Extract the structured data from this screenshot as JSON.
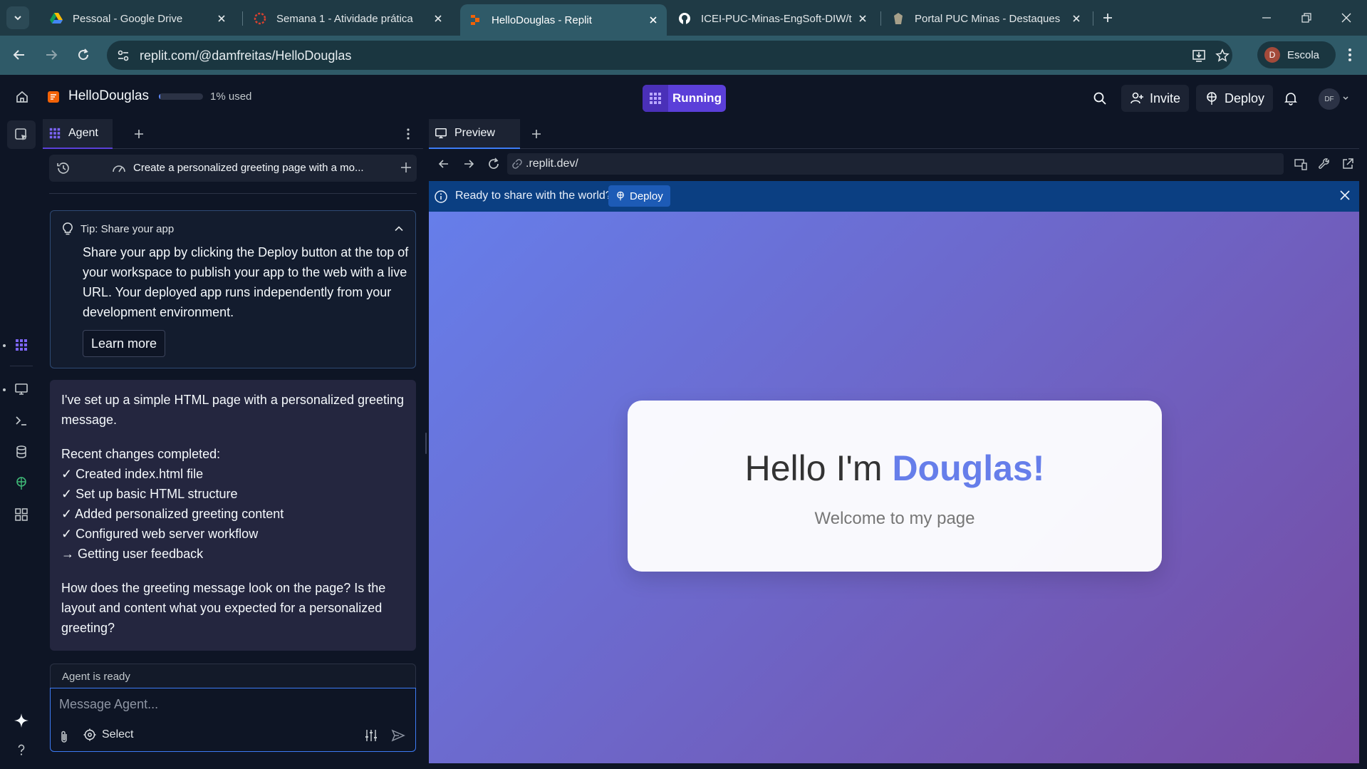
{
  "browser": {
    "tabs": [
      {
        "title": "Pessoal - Google Drive",
        "icon": "google-drive-icon"
      },
      {
        "title": "Semana 1 - Atividade prática",
        "icon": "puc-logo-icon"
      },
      {
        "title": "HelloDouglas - Replit",
        "icon": "replit-icon",
        "active": true
      },
      {
        "title": "ICEI-PUC-Minas-EngSoft-DIW/t",
        "icon": "github-icon"
      },
      {
        "title": "Portal PUC Minas - Destaques",
        "icon": "puc-portal-icon"
      }
    ],
    "url": "replit.com/@damfreitas/HelloDouglas",
    "profile_initial": "D",
    "profile_name": "Escola"
  },
  "header": {
    "project_name": "HelloDouglas",
    "usage_percent": 1,
    "usage_text": "1% used",
    "run_label": "Running",
    "invite_label": "Invite",
    "deploy_label": "Deploy",
    "user_initials": "DF"
  },
  "agent": {
    "tab_label": "Agent",
    "thread_title": "Create a personalized greeting page with a mo...",
    "tip": {
      "title": "Tip: Share your app",
      "body": "Share your app by clicking the Deploy button at the top of your workspace to publish your app to the web with a live URL. Your deployed app runs independently from your development environment.",
      "button": "Learn more"
    },
    "message": {
      "intro": "I've set up a simple HTML page with a personalized greeting message.",
      "changes_heading": "Recent changes completed:",
      "changes": [
        "✓ Created index.html file",
        "✓ Set up basic HTML structure",
        "✓ Added personalized greeting content",
        "✓ Configured web server workflow",
        "→ Getting user feedback"
      ],
      "question": "How does the greeting message look on the page? Is the layout and content what you expected for a personalized greeting?"
    },
    "status": "Agent is ready",
    "input_placeholder": "Message Agent...",
    "select_label": "Select"
  },
  "preview": {
    "tab_label": "Preview",
    "url": ".replit.dev/",
    "banner_text": "Ready to share with the world?",
    "banner_button": "Deploy",
    "page": {
      "greeting_prefix": "Hello I'm ",
      "greeting_name": "Douglas!",
      "subtitle": "Welcome to my page"
    }
  },
  "colors": {
    "accent_purple": "#5b3fd9",
    "focus_blue": "#3d7bf5",
    "banner_blue": "#0b3f82",
    "gradient_start": "#667eea",
    "gradient_end": "#764ba2"
  }
}
